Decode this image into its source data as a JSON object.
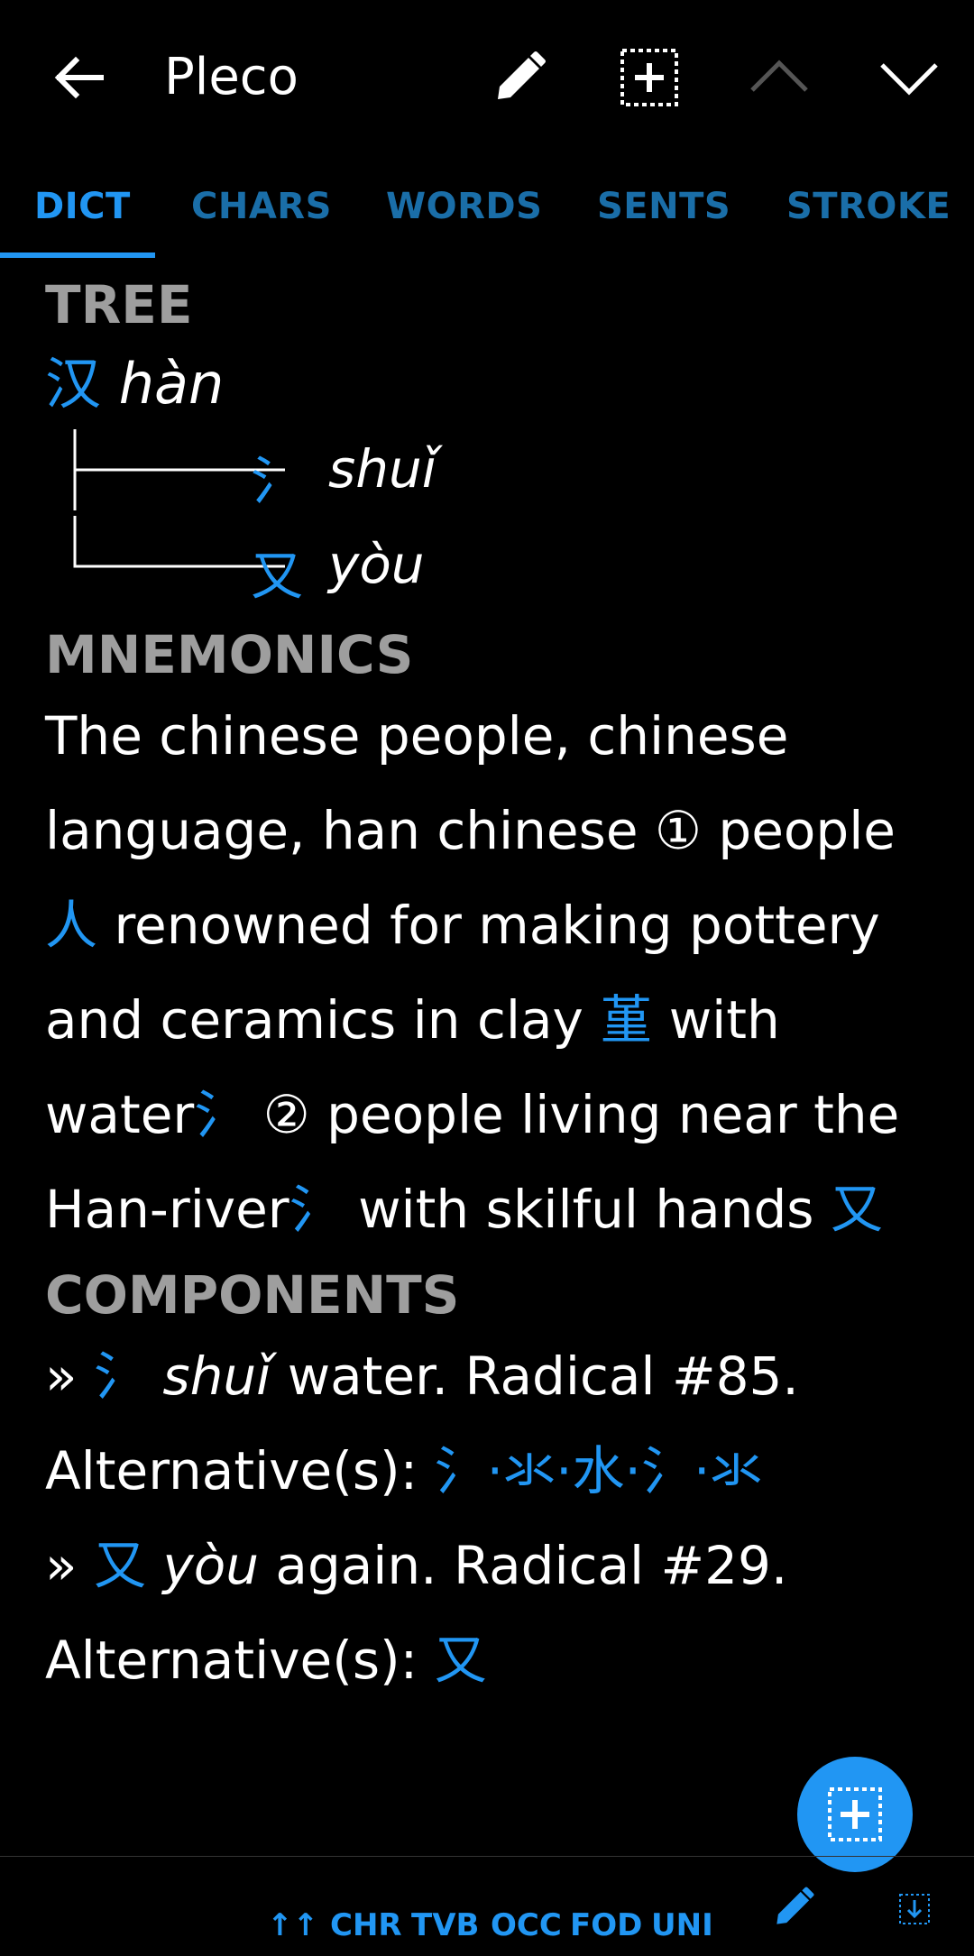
{
  "appbar": {
    "title": "Pleco"
  },
  "tabs": [
    "DICT",
    "CHARS",
    "WORDS",
    "SENTS",
    "STROKE"
  ],
  "tree": {
    "heading": "TREE",
    "root": {
      "char": "汉",
      "pinyin": "hàn"
    },
    "children": [
      {
        "char": "氵",
        "pinyin": "shuǐ"
      },
      {
        "char": "又",
        "pinyin": "yòu"
      }
    ]
  },
  "mnemonics": {
    "heading": "MNEMONICS",
    "p1": "The chinese people, chinese language, han chinese",
    "n1": "①",
    "p2": "people",
    "c1": "人",
    "p3": "renowned for making pottery and ceramics in clay",
    "c2": "堇",
    "p4": "with water",
    "c3": "氵",
    "n2": "②",
    "p5": "people living near the Han-river",
    "c4": "氵",
    "p6": "with skilful hands",
    "c5": "又"
  },
  "components": {
    "heading": "COMPONENTS",
    "c1": {
      "mark": "»",
      "char": "氵",
      "pinyin": "shuǐ",
      "desc": "water. Radical #85.",
      "alt_label": "Alternative(s):",
      "alts": "氵·氺·水·氵·氺"
    },
    "c2": {
      "mark": "»",
      "char": "又",
      "pinyin": "yòu",
      "desc": "again. Radical #29.",
      "alt_label": "Alternative(s):",
      "alts": "又"
    }
  },
  "bottombar": {
    "arrows": "↑↑",
    "items": [
      "CHR",
      "TVB",
      "OCC",
      "FOD",
      "UNI"
    ]
  }
}
